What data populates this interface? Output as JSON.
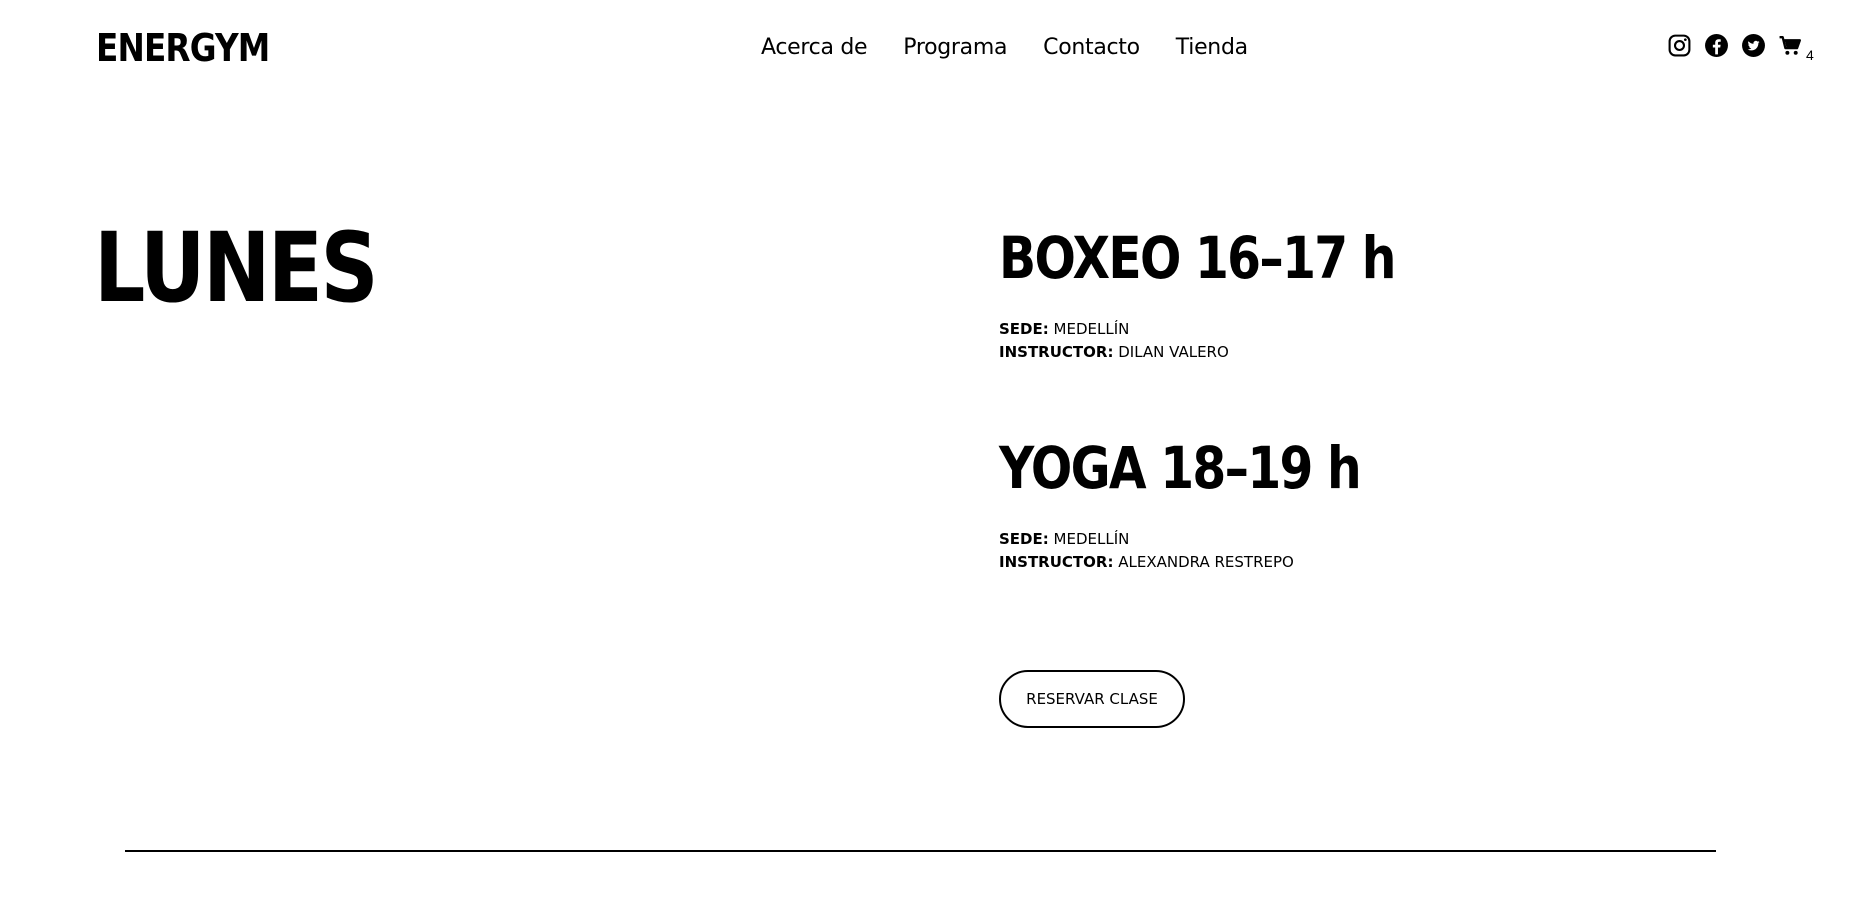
{
  "header": {
    "logo": "ENERGYM",
    "nav": [
      "Acerca de",
      "Programa",
      "Contacto",
      "Tienda"
    ],
    "social_icons": [
      "instagram-icon",
      "facebook-icon",
      "twitter-icon"
    ],
    "cart": {
      "icon": "cart-icon",
      "count": "4"
    }
  },
  "schedule": {
    "day": "LUNES",
    "classes": [
      {
        "title": "BOXEO 16–17 h",
        "sede_label": "SEDE:",
        "sede": "MEDELLÍN",
        "instructor_label": "INSTRUCTOR:",
        "instructor": "DILAN VALERO"
      },
      {
        "title": "YOGA 18–19 h",
        "sede_label": "SEDE:",
        "sede": "MEDELLÍN",
        "instructor_label": "INSTRUCTOR:",
        "instructor": "ALEXANDRA RESTREPO"
      }
    ],
    "reserve_label": "RESERVAR CLASE"
  },
  "colors": {
    "text": "#000000",
    "background": "#ffffff"
  }
}
